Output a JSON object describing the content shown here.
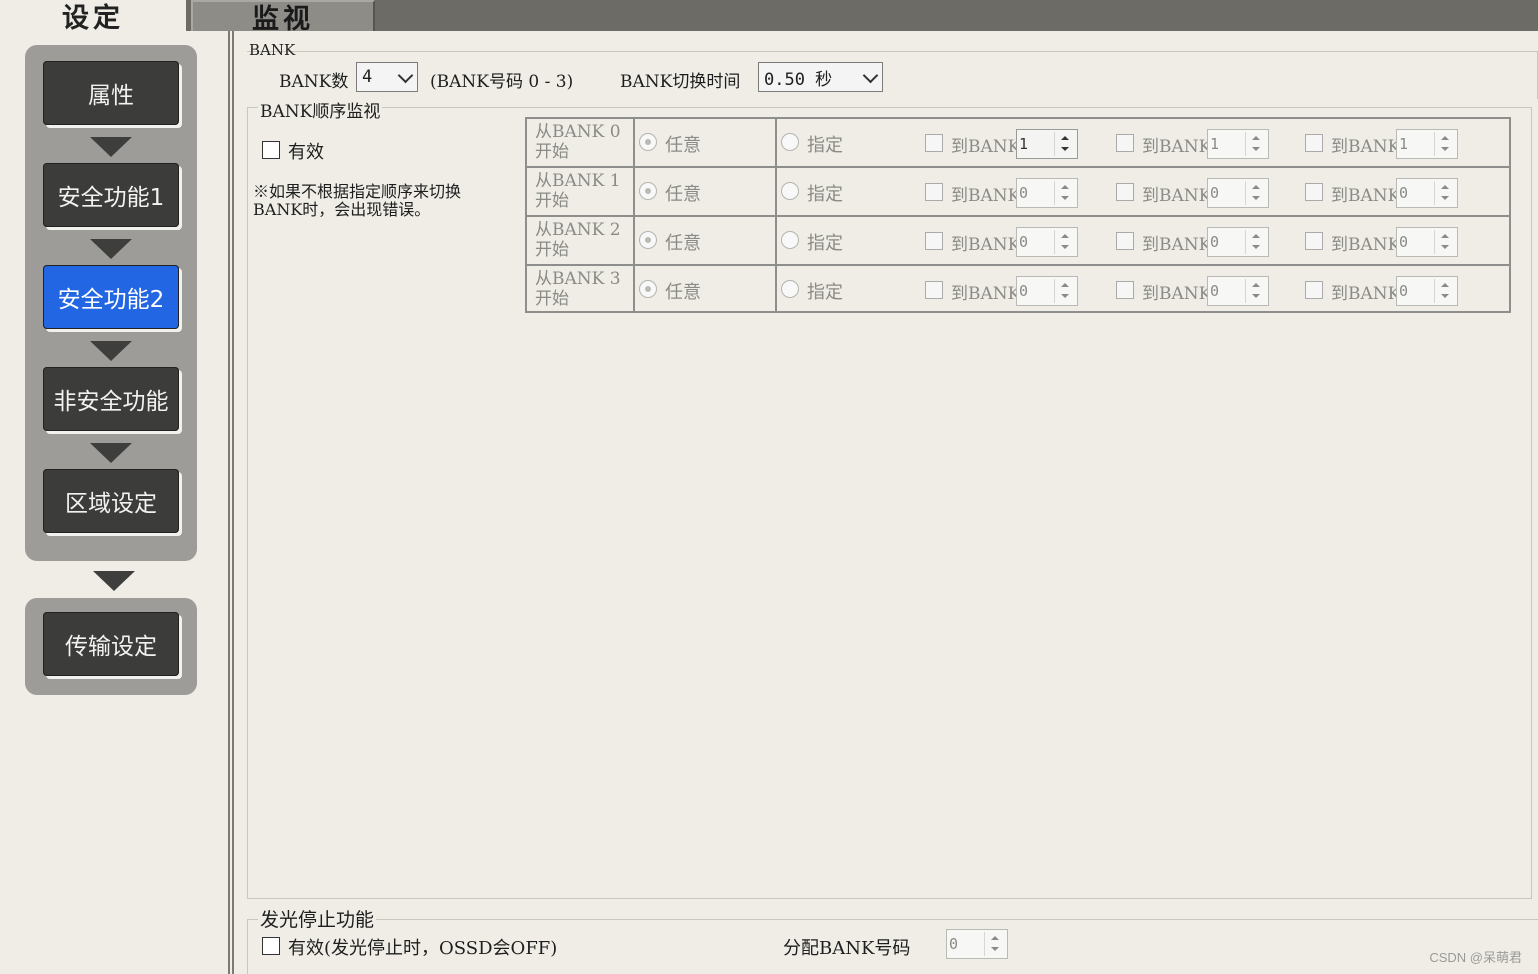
{
  "tabs": {
    "settings": "设定",
    "monitor": "监视"
  },
  "sidebar": {
    "items": [
      {
        "label": "属性"
      },
      {
        "label": "安全功能1"
      },
      {
        "label": "安全功能2"
      },
      {
        "label": "非安全功能"
      },
      {
        "label": "区域设定"
      }
    ],
    "transfer": "传输设定",
    "selected_index": 2,
    "selected_color": "#2266e3"
  },
  "bank": {
    "group_title": "BANK",
    "count_label": "BANK数",
    "count_value": "4",
    "range_note": "(BANK号码 0 - 3)",
    "switch_time_label": "BANK切换时间",
    "switch_time_value": "0.50 秒"
  },
  "sequence": {
    "group_title": "BANK顺序监视",
    "valid_label": "有效",
    "note": "※如果不根据指定顺序来切换BANK时，会出现错误。",
    "rows": [
      {
        "from_line1": "从BANK 0",
        "from_line2": "开始",
        "any": "任意",
        "specify": "指定",
        "to1_label": "到BANK",
        "to1": "1",
        "to2_label": "到BANK",
        "to2": "1",
        "to3_label": "到BANK",
        "to3": "1"
      },
      {
        "from_line1": "从BANK 1",
        "from_line2": "开始",
        "any": "任意",
        "specify": "指定",
        "to1_label": "到BANK",
        "to1": "0",
        "to2_label": "到BANK",
        "to2": "0",
        "to3_label": "到BANK",
        "to3": "0"
      },
      {
        "from_line1": "从BANK 2",
        "from_line2": "开始",
        "any": "任意",
        "specify": "指定",
        "to1_label": "到BANK",
        "to1": "0",
        "to2_label": "到BANK",
        "to2": "0",
        "to3_label": "到BANK",
        "to3": "0"
      },
      {
        "from_line1": "从BANK 3",
        "from_line2": "开始",
        "any": "任意",
        "specify": "指定",
        "to1_label": "到BANK",
        "to1": "0",
        "to2_label": "到BANK",
        "to2": "0",
        "to3_label": "到BANK",
        "to3": "0"
      }
    ]
  },
  "emission_stop": {
    "group_title": "发光停止功能",
    "valid_label": "有效(发光停止时，OSSD会OFF)",
    "assign_label": "分配BANK号码",
    "assign_value": "0"
  },
  "watermark": "CSDN @呆萌君"
}
